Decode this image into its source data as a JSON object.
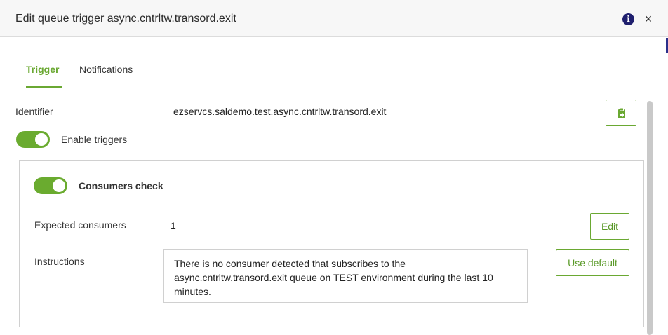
{
  "modal": {
    "title": "Edit queue trigger async.cntrltw.transord.exit",
    "info_icon": "info-circle-icon",
    "close_label": "×"
  },
  "tabs": [
    {
      "label": "Trigger",
      "active": true
    },
    {
      "label": "Notifications",
      "active": false
    }
  ],
  "identifier": {
    "label": "Identifier",
    "value": "ezservcs.saldemo.test.async.cntrltw.transord.exit",
    "copy_icon": "copy-clipboard-icon"
  },
  "enable_triggers": {
    "label": "Enable triggers",
    "enabled": true
  },
  "consumers_check": {
    "title": "Consumers check",
    "enabled": true,
    "expected_consumers_label": "Expected consumers",
    "expected_consumers_value": "1",
    "edit_label": "Edit",
    "instructions_label": "Instructions",
    "instructions_text": "There is no consumer detected that subscribes to the async.cntrltw.transord.exit queue on TEST environment during the last 10 minutes.",
    "use_default_label": "Use default"
  },
  "colors": {
    "accent": "#6aa832",
    "toggle_on": "#6aab2f",
    "info_icon_bg": "#1f1f6e"
  }
}
